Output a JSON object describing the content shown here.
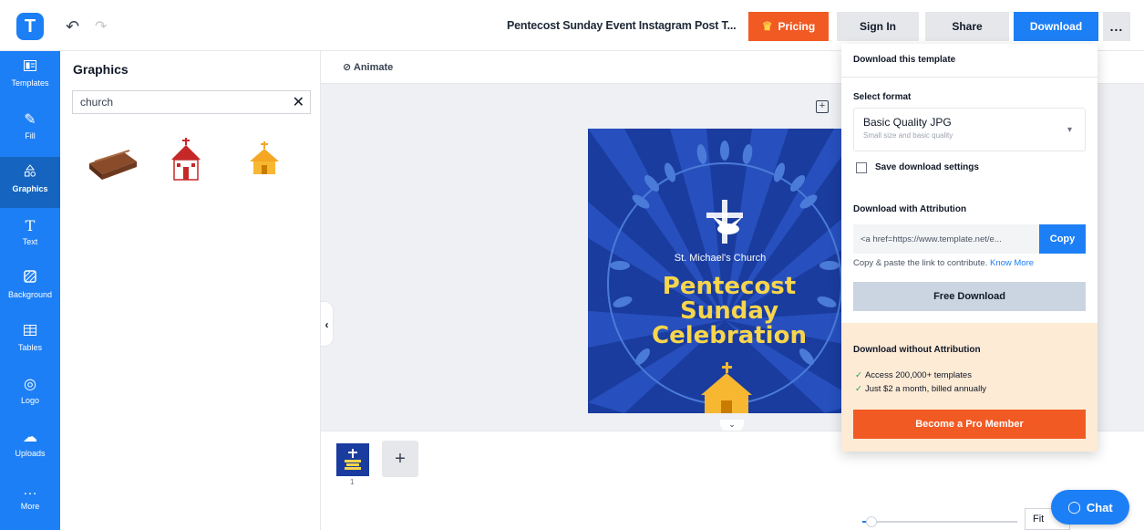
{
  "app": {
    "logo_letter": "T",
    "doc_title": "Pentecost Sunday Event Instagram Post T...",
    "undo_icon": "undo-icon",
    "redo_icon": "redo-icon"
  },
  "header": {
    "pricing_label": "Pricing",
    "signin_label": "Sign In",
    "share_label": "Share",
    "download_label": "Download",
    "more_label": "..."
  },
  "sidebar": {
    "items": [
      {
        "label": "Templates",
        "icon": "templates-icon"
      },
      {
        "label": "Fill",
        "icon": "fill-icon"
      },
      {
        "label": "Graphics",
        "icon": "graphics-icon"
      },
      {
        "label": "Text",
        "icon": "text-icon"
      },
      {
        "label": "Background",
        "icon": "background-icon"
      },
      {
        "label": "Tables",
        "icon": "tables-icon"
      },
      {
        "label": "Logo",
        "icon": "logo-icon"
      },
      {
        "label": "Uploads",
        "icon": "uploads-icon"
      },
      {
        "label": "More",
        "icon": "more-icon"
      }
    ]
  },
  "panel": {
    "title": "Graphics",
    "search_value": "church",
    "results": [
      "wooden-pew-graphic",
      "red-church-graphic",
      "orange-church-graphic"
    ]
  },
  "toolbar": {
    "animate_label": "Animate"
  },
  "design": {
    "church_name": "St. Michael's Church",
    "headline_lines": [
      "Pentecost",
      "Sunday",
      "Celebration"
    ],
    "colors": {
      "background": "#1a3c9e",
      "headline": "#f7d54c",
      "leaves": "#4a7bd8"
    }
  },
  "pages": {
    "current": "1",
    "add_label": "+"
  },
  "zoom": {
    "fit_label": "Fit",
    "level": 0.06
  },
  "download_menu": {
    "header": "Download this template",
    "select_format_label": "Select format",
    "format_value": "Basic Quality JPG",
    "format_sub": "Small size and basic quality",
    "save_settings_label": "Save download settings",
    "with_attribution_label": "Download with Attribution",
    "attribution_value": "<a href=https://www.template.net/e...",
    "copy_label": "Copy",
    "copy_hint": "Copy & paste the link to contribute.",
    "know_more_label": "Know More",
    "free_download_label": "Free Download",
    "without_attribution_label": "Download without Attribution",
    "pro_benefits": [
      "Access 200,000+ templates",
      "Just $2 a month, billed annually"
    ],
    "pro_button_label": "Become a Pro Member"
  },
  "chat": {
    "label": "Chat"
  },
  "colors": {
    "primary": "#1d7ff5",
    "accent": "#f25a24",
    "pro_bg": "#fdebd6"
  }
}
